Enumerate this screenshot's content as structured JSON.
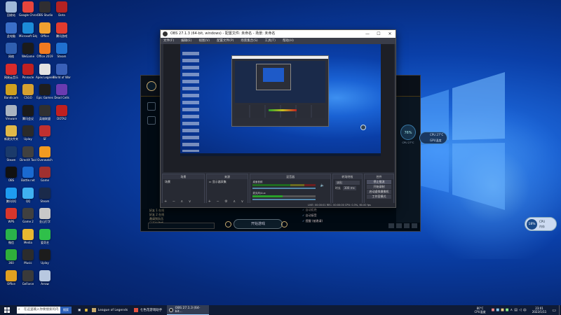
{
  "desktop_icons": [
    {
      "label": "回收站",
      "color": "#9fb8d8",
      "col": 0,
      "row": 0
    },
    {
      "label": "Google Chrome",
      "color": "#e8453c",
      "col": 1,
      "row": 0
    },
    {
      "label": "OBS Studio",
      "color": "#302e31",
      "col": 2,
      "row": 0
    },
    {
      "label": "Dota",
      "color": "#b32222",
      "col": 3,
      "row": 0
    },
    {
      "label": "此电脑",
      "color": "#3a6fc8",
      "col": 0,
      "row": 1
    },
    {
      "label": "Microsoft Edge",
      "color": "#1c8bd8",
      "col": 1,
      "row": 1
    },
    {
      "label": "Office",
      "color": "#f0a030",
      "col": 2,
      "row": 1
    },
    {
      "label": "腾讯游戏",
      "color": "#e23b2e",
      "col": 3,
      "row": 1
    },
    {
      "label": "网络",
      "color": "#2f5fb0",
      "col": 0,
      "row": 2
    },
    {
      "label": "WeGame",
      "color": "#1b1b1b",
      "col": 1,
      "row": 2
    },
    {
      "label": "Office 2019",
      "color": "#f07a20",
      "col": 2,
      "row": 2
    },
    {
      "label": "Steam",
      "color": "#2070d0",
      "col": 3,
      "row": 2
    },
    {
      "label": "网易云音乐",
      "color": "#d82b2b",
      "col": 0,
      "row": 3
    },
    {
      "label": "Pinnacle",
      "color": "#c02020",
      "col": 1,
      "row": 3
    },
    {
      "label": "Apex Legends",
      "color": "#e2e2e2",
      "col": 2,
      "row": 3
    },
    {
      "label": "World of Warcraft",
      "color": "#3960b8",
      "col": 3,
      "row": 3
    },
    {
      "label": "Bandicam",
      "color": "#d0a020",
      "col": 0,
      "row": 4
    },
    {
      "label": "CSGO",
      "color": "#d6a030",
      "col": 1,
      "row": 4
    },
    {
      "label": "Epic Games",
      "color": "#1e1e1e",
      "col": 2,
      "row": 4
    },
    {
      "label": "Dead Cells",
      "color": "#6a3bb0",
      "col": 3,
      "row": 4
    },
    {
      "label": "Vmware",
      "color": "#aab4c0",
      "col": 0,
      "row": 5
    },
    {
      "label": "腾讯会议",
      "color": "#1a1a1a",
      "col": 1,
      "row": 5
    },
    {
      "label": "英雄联盟",
      "color": "#303030",
      "col": 2,
      "row": 5
    },
    {
      "label": "DOTA2",
      "color": "#c02020",
      "col": 3,
      "row": 5
    },
    {
      "label": "新建文件夹",
      "color": "#e0b848",
      "col": 0,
      "row": 6
    },
    {
      "label": "Uplay",
      "color": "#2a2a2a",
      "col": 1,
      "row": 6
    },
    {
      "label": "SF",
      "color": "#c03030",
      "col": 2,
      "row": 6
    },
    {
      "label": "Steam",
      "color": "#1b3a6a",
      "col": 0,
      "row": 7
    },
    {
      "label": "DirectX Tool",
      "color": "#404040",
      "col": 1,
      "row": 7
    },
    {
      "label": "Overwatch",
      "color": "#f29a20",
      "col": 2,
      "row": 7
    },
    {
      "label": "OBS",
      "color": "#111111",
      "col": 0,
      "row": 8
    },
    {
      "label": "Battle.net",
      "color": "#1a6ad0",
      "col": 1,
      "row": 8
    },
    {
      "label": "Game",
      "color": "#a03030",
      "col": 2,
      "row": 8
    },
    {
      "label": "腾讯QQ",
      "color": "#1e9cf0",
      "col": 0,
      "row": 9
    },
    {
      "label": "QQ",
      "color": "#3fb0f0",
      "col": 1,
      "row": 9
    },
    {
      "label": "Steam",
      "color": "#1a2a4a",
      "col": 2,
      "row": 9
    },
    {
      "label": "WPS",
      "color": "#d8362c",
      "col": 0,
      "row": 10
    },
    {
      "label": "Game 2",
      "color": "#404040",
      "col": 1,
      "row": 10
    },
    {
      "label": "金山打字",
      "color": "#c8c8c8",
      "col": 2,
      "row": 10
    },
    {
      "label": "微信",
      "color": "#2ab24a",
      "col": 0,
      "row": 11
    },
    {
      "label": "Media",
      "color": "#e8b830",
      "col": 1,
      "row": 11
    },
    {
      "label": "爱奇艺",
      "color": "#2fc04a",
      "col": 2,
      "row": 11
    },
    {
      "label": "360",
      "color": "#2fae3a",
      "col": 0,
      "row": 12
    },
    {
      "label": "Music",
      "color": "#2c2c2c",
      "col": 1,
      "row": 12
    },
    {
      "label": "Uplay",
      "color": "#1c1c1c",
      "col": 2,
      "row": 12
    },
    {
      "label": "Office",
      "color": "#e0a020",
      "col": 0,
      "row": 13
    },
    {
      "label": "GeForce",
      "color": "#3a3a3a",
      "col": 1,
      "row": 13
    },
    {
      "label": "Arrow",
      "color": "#b8c8e0",
      "col": 2,
      "row": 13
    }
  ],
  "obs": {
    "title": "OBS 27.1.3 (64-bit, windows) - 配置文件: 未命名 - 场景: 未命名",
    "menu": [
      "文件(F)",
      "编辑(E)",
      "视图(V)",
      "配置文件(P)",
      "场景集合(S)",
      "工具(T)",
      "帮助(H)"
    ],
    "panels": {
      "scenes": {
        "title": "场景",
        "items": [
          "场景"
        ]
      },
      "sources": {
        "title": "来源",
        "items": [
          "显示器采集"
        ]
      },
      "mixer": {
        "title": "混音器",
        "tracks": [
          "桌面音频",
          "麦克风/Aux"
        ]
      },
      "transitions": {
        "title": "转场特效",
        "type": "淡出",
        "duration_label": "时长",
        "duration": "300 ms"
      },
      "controls": {
        "title": "控件",
        "buttons": [
          "停止推流",
          "开始录制",
          "启动虚拟摄像机",
          "工作室模式",
          "设置",
          "退出"
        ]
      }
    },
    "status": "LIVE: 00:00:01   REC: 00:00:00   CPU: 0.3%, 60.00 fps",
    "source_none": "未选择源"
  },
  "lol": {
    "chat_lines": [
      "好友 1 在线",
      "好友 2 在线",
      "邀请到队伍",
      "已开始游戏"
    ],
    "list_items": [
      "自动拒绝",
      "自动接受",
      "提醒 (被邀请)"
    ],
    "play_label": "开始游戏",
    "side_label": "英雄联盟"
  },
  "taskbar": {
    "search_placeholder": "在这里输入你要搜索的内容",
    "search_btn": "搜索",
    "apps": [
      {
        "label": "League of Legends",
        "active": false
      },
      {
        "label": "七色花游戏助手",
        "active": false
      },
      {
        "label": "OBS 27.1.3 (64-bit...",
        "active": true
      }
    ],
    "weather_temp": "80°C",
    "weather_desc": "CPU温度",
    "time": "23:01",
    "date": "2022/1/11"
  },
  "overlay_widget": {
    "percent": "18%",
    "cpu_label": "CPU",
    "mem_label": "内存"
  },
  "lol_widget": {
    "percent": "76%",
    "cpu": "CPU 27°C",
    "gpu": "GPU温度"
  }
}
